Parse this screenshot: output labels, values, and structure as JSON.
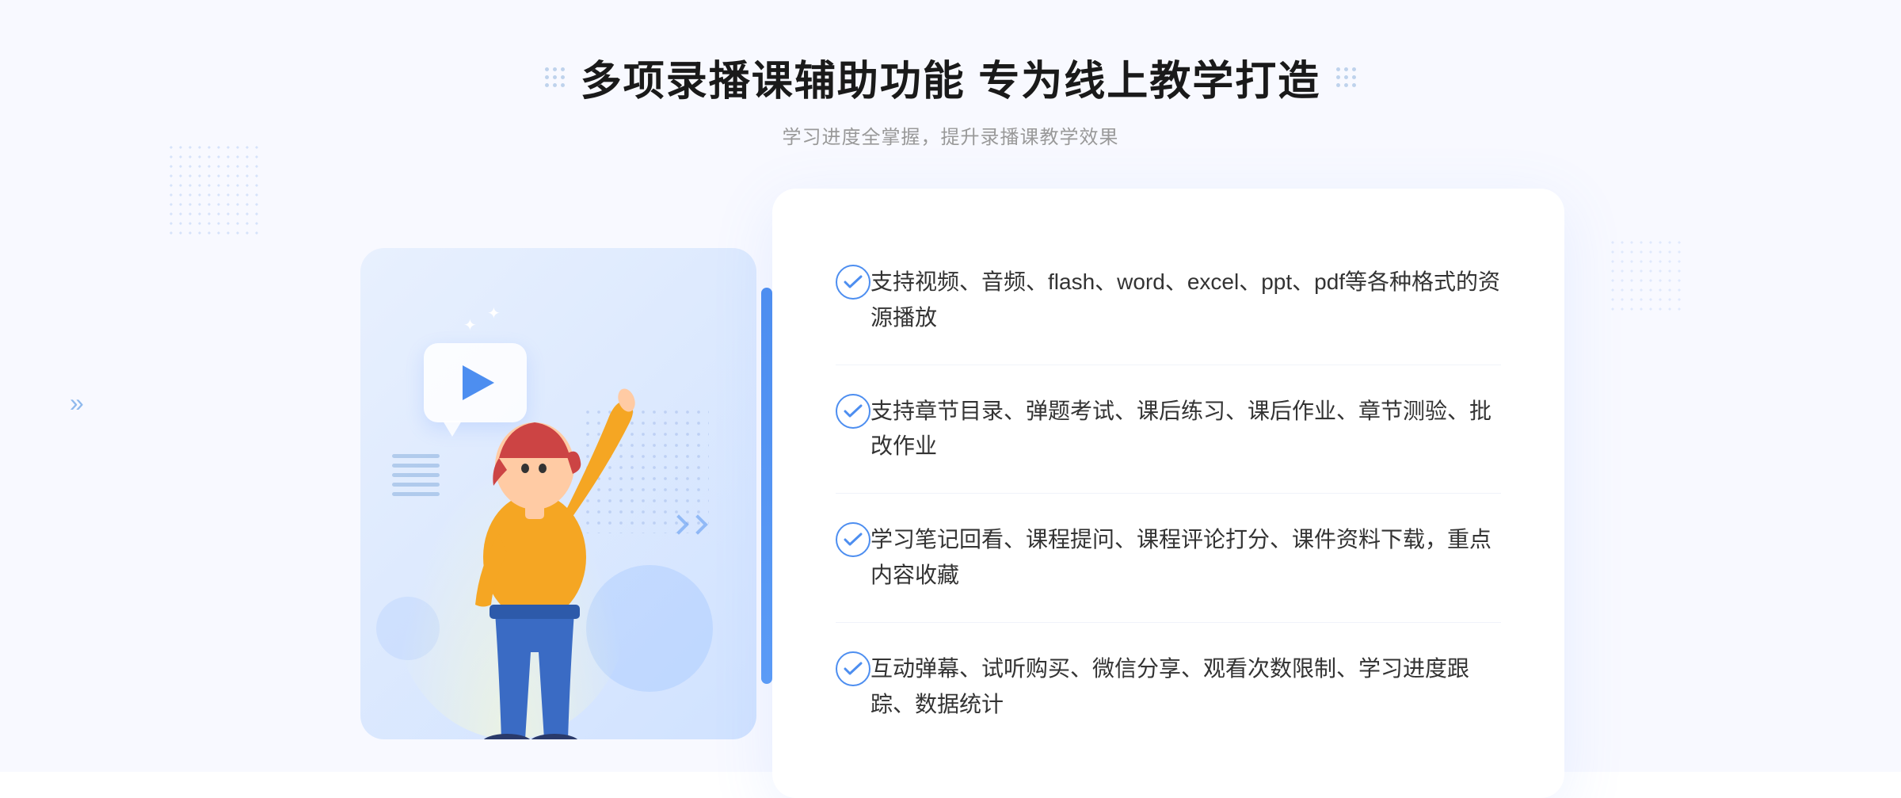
{
  "page": {
    "background": "#f8f9ff"
  },
  "header": {
    "title": "多项录播课辅助功能 专为线上教学打造",
    "subtitle": "学习进度全掌握，提升录播课教学效果",
    "dots_decoration": "grid-dots"
  },
  "features": [
    {
      "id": 1,
      "text": "支持视频、音频、flash、word、excel、ppt、pdf等各种格式的资源播放"
    },
    {
      "id": 2,
      "text": "支持章节目录、弹题考试、课后练习、课后作业、章节测验、批改作业"
    },
    {
      "id": 3,
      "text": "学习笔记回看、课程提问、课程评论打分、课件资料下载，重点内容收藏"
    },
    {
      "id": 4,
      "text": "互动弹幕、试听购买、微信分享、观看次数限制、学习进度跟踪、数据统计"
    }
  ],
  "illustration": {
    "play_icon": "▶",
    "arrow_left": "»"
  }
}
